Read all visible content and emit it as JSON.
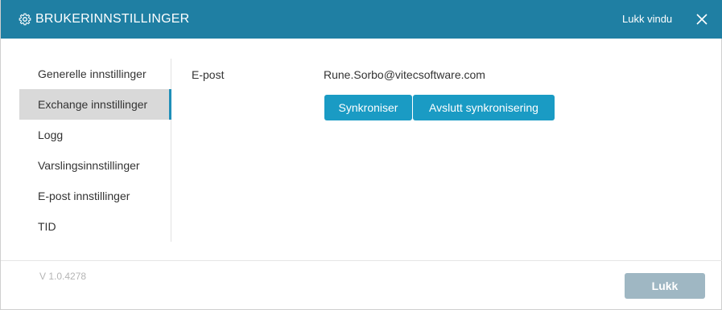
{
  "header": {
    "title": "BRUKERINNSTILLINGER",
    "close_label": "Lukk vindu",
    "icon": "gear-icon",
    "close_icon": "close-icon",
    "color": "#1f7fa3"
  },
  "sidebar": {
    "items": [
      {
        "label": "Generelle innstillinger",
        "active": false
      },
      {
        "label": "Exchange innstillinger",
        "active": true
      },
      {
        "label": "Logg",
        "active": false
      },
      {
        "label": "Varslingsinnstillinger",
        "active": false
      },
      {
        "label": "E-post innstillinger",
        "active": false
      },
      {
        "label": "TID",
        "active": false
      }
    ]
  },
  "main": {
    "email_label": "E-post",
    "email_value": "Rune.Sorbo@vitecsoftware.com",
    "sync_button": "Synkroniser",
    "stop_sync_button": "Avslutt synkronisering",
    "button_color": "#1a9bc4"
  },
  "footer": {
    "version": "V 1.0.4278",
    "close_button": "Lukk"
  }
}
